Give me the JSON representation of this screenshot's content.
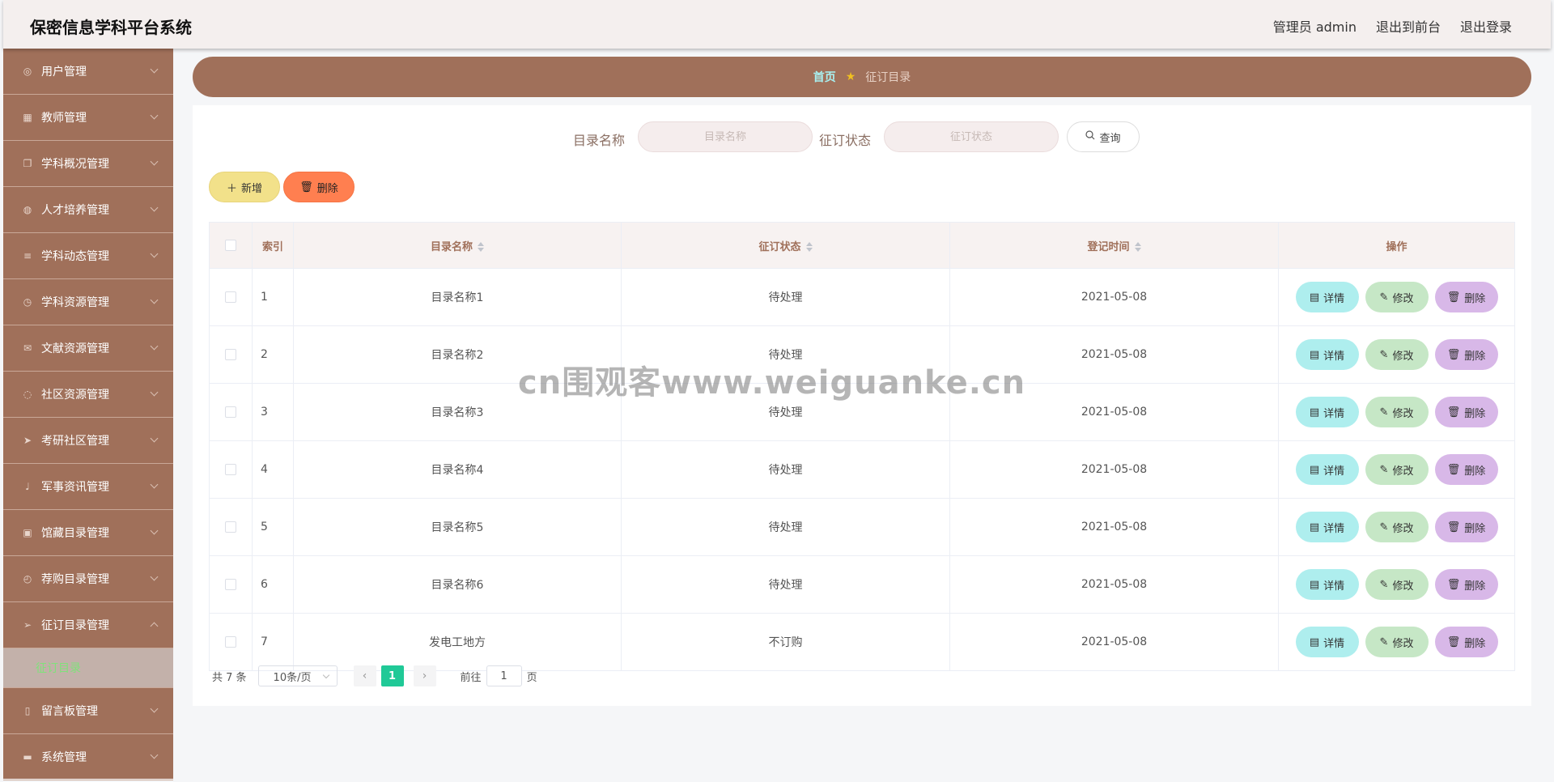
{
  "header": {
    "app_title": "保密信息学科平台系统",
    "user_label": "管理员 admin",
    "goto_front_label": "退出到前台",
    "logout_label": "退出登录"
  },
  "sidebar": {
    "items": [
      {
        "label": "用户管理",
        "icon": "user-circle-icon"
      },
      {
        "label": "教师管理",
        "icon": "grid-icon"
      },
      {
        "label": "学科概况管理",
        "icon": "copy-icon"
      },
      {
        "label": "人才培养管理",
        "icon": "globe-icon"
      },
      {
        "label": "学科动态管理",
        "icon": "menu-icon"
      },
      {
        "label": "学科资源管理",
        "icon": "clock-icon"
      },
      {
        "label": "文献资源管理",
        "icon": "message-icon"
      },
      {
        "label": "社区资源管理",
        "icon": "compass-icon"
      },
      {
        "label": "考研社区管理",
        "icon": "send-icon"
      },
      {
        "label": "军事资讯管理",
        "icon": "microphone-icon"
      },
      {
        "label": "馆藏目录管理",
        "icon": "checkbox-icon"
      },
      {
        "label": "荐购目录管理",
        "icon": "time-icon"
      },
      {
        "label": "征订目录管理",
        "icon": "navigation-icon"
      }
    ],
    "active_sub": "征订目录",
    "after_items": [
      {
        "label": "留言板管理",
        "icon": "phone-icon"
      },
      {
        "label": "系统管理",
        "icon": "monitor-icon"
      }
    ]
  },
  "breadcrumb": {
    "home": "首页",
    "current": "征订目录"
  },
  "search": {
    "name_label": "目录名称",
    "name_placeholder": "目录名称",
    "status_label": "征订状态",
    "status_placeholder": "征订状态",
    "query_label": "查询"
  },
  "actions": {
    "add_label": "新增",
    "delete_label": "删除"
  },
  "table": {
    "headers": {
      "index": "索引",
      "name": "目录名称",
      "status": "征订状态",
      "time": "登记时间",
      "ops": "操作"
    },
    "rows": [
      {
        "index": "1",
        "name": "目录名称1",
        "status": "待处理",
        "time": "2021-05-08"
      },
      {
        "index": "2",
        "name": "目录名称2",
        "status": "待处理",
        "time": "2021-05-08"
      },
      {
        "index": "3",
        "name": "目录名称3",
        "status": "待处理",
        "time": "2021-05-08"
      },
      {
        "index": "4",
        "name": "目录名称4",
        "status": "待处理",
        "time": "2021-05-08"
      },
      {
        "index": "5",
        "name": "目录名称5",
        "status": "待处理",
        "time": "2021-05-08"
      },
      {
        "index": "6",
        "name": "目录名称6",
        "status": "待处理",
        "time": "2021-05-08"
      },
      {
        "index": "7",
        "name": "发电工地方",
        "status": "不订购",
        "time": "2021-05-08"
      }
    ],
    "op_detail": "详情",
    "op_edit": "修改",
    "op_delete": "删除"
  },
  "pagination": {
    "total": "共 7 条",
    "page_size": "10条/页",
    "current_page": "1",
    "goto_prefix": "前往",
    "goto_value": "1",
    "goto_suffix": "页"
  },
  "watermark": "cn围观客www.weiguanke.cn",
  "colors": {
    "brand": "#a0705a",
    "active_page": "#20c997"
  }
}
